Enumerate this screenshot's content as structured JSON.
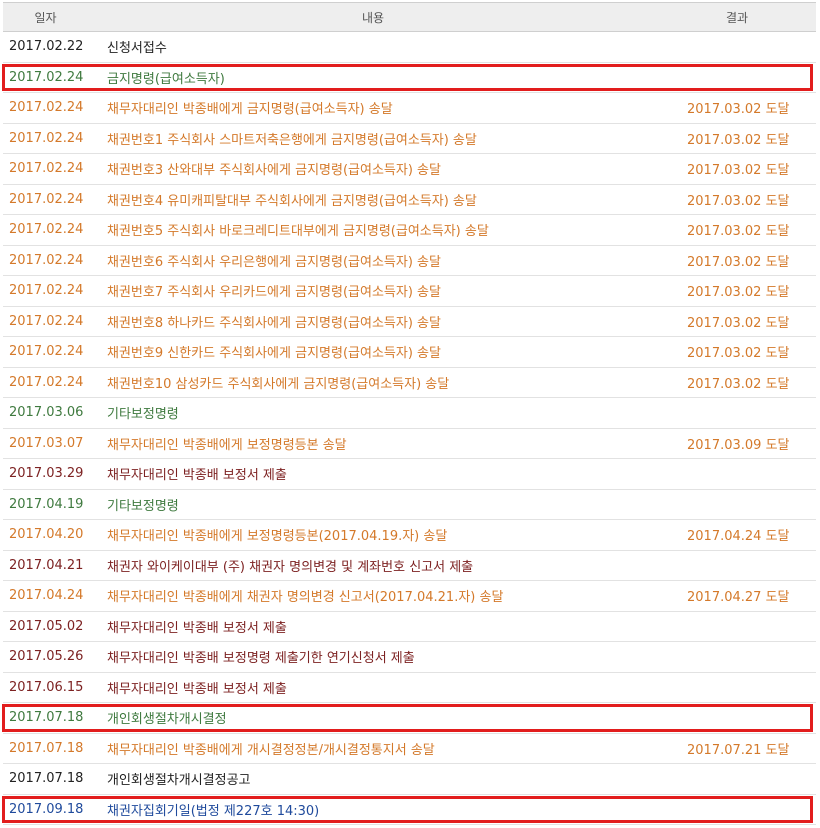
{
  "header": {
    "date": "일자",
    "content": "내용",
    "result": "결과"
  },
  "colors": {
    "black": "#222222",
    "green": "#3f7a3f",
    "orange": "#d4792a",
    "maroon": "#7d2222",
    "blue": "#1f4a9c",
    "highlight_border": "#e21d1d"
  },
  "rows": [
    {
      "date": "2017.02.22",
      "content": "신청서접수",
      "result": "",
      "color": "black",
      "highlight": false
    },
    {
      "date": "2017.02.24",
      "content": "금지명령(급여소득자)",
      "result": "",
      "color": "green",
      "highlight": true
    },
    {
      "date": "2017.02.24",
      "content": "채무자대리인 박종배에게 금지명령(급여소득자) 송달",
      "result": "2017.03.02 도달",
      "color": "orange",
      "highlight": false
    },
    {
      "date": "2017.02.24",
      "content": "채권번호1 주식회사 스마트저축은행에게 금지명령(급여소득자) 송달",
      "result": "2017.03.02 도달",
      "color": "orange",
      "highlight": false
    },
    {
      "date": "2017.02.24",
      "content": "채권번호3 산와대부 주식회사에게 금지명령(급여소득자) 송달",
      "result": "2017.03.02 도달",
      "color": "orange",
      "highlight": false
    },
    {
      "date": "2017.02.24",
      "content": "채권번호4 유미캐피탈대부 주식회사에게 금지명령(급여소득자) 송달",
      "result": "2017.03.02 도달",
      "color": "orange",
      "highlight": false
    },
    {
      "date": "2017.02.24",
      "content": "채권번호5 주식회사 바로크레디트대부에게 금지명령(급여소득자) 송달",
      "result": "2017.03.02 도달",
      "color": "orange",
      "highlight": false
    },
    {
      "date": "2017.02.24",
      "content": "채권번호6 주식회사 우리은행에게 금지명령(급여소득자) 송달",
      "result": "2017.03.02 도달",
      "color": "orange",
      "highlight": false
    },
    {
      "date": "2017.02.24",
      "content": "채권번호7 주식회사 우리카드에게 금지명령(급여소득자) 송달",
      "result": "2017.03.02 도달",
      "color": "orange",
      "highlight": false
    },
    {
      "date": "2017.02.24",
      "content": "채권번호8 하나카드 주식회사에게 금지명령(급여소득자) 송달",
      "result": "2017.03.02 도달",
      "color": "orange",
      "highlight": false
    },
    {
      "date": "2017.02.24",
      "content": "채권번호9 신한카드 주식회사에게 금지명령(급여소득자) 송달",
      "result": "2017.03.02 도달",
      "color": "orange",
      "highlight": false
    },
    {
      "date": "2017.02.24",
      "content": "채권번호10 삼성카드 주식회사에게 금지명령(급여소득자) 송달",
      "result": "2017.03.02 도달",
      "color": "orange",
      "highlight": false
    },
    {
      "date": "2017.03.06",
      "content": "기타보정명령",
      "result": "",
      "color": "green",
      "highlight": false
    },
    {
      "date": "2017.03.07",
      "content": "채무자대리인 박종배에게 보정명령등본 송달",
      "result": "2017.03.09 도달",
      "color": "orange",
      "highlight": false
    },
    {
      "date": "2017.03.29",
      "content": "채무자대리인 박종배 보정서 제출",
      "result": "",
      "color": "maroon",
      "highlight": false
    },
    {
      "date": "2017.04.19",
      "content": "기타보정명령",
      "result": "",
      "color": "green",
      "highlight": false
    },
    {
      "date": "2017.04.20",
      "content": "채무자대리인 박종배에게 보정명령등본(2017.04.19.자) 송달",
      "result": "2017.04.24 도달",
      "color": "orange",
      "highlight": false
    },
    {
      "date": "2017.04.21",
      "content": "채권자 와이케이대부 (주) 채권자 명의변경 및 계좌번호 신고서 제출",
      "result": "",
      "color": "maroon",
      "highlight": false
    },
    {
      "date": "2017.04.24",
      "content": "채무자대리인 박종배에게 채권자 명의변경 신고서(2017.04.21.자) 송달",
      "result": "2017.04.27 도달",
      "color": "orange",
      "highlight": false
    },
    {
      "date": "2017.05.02",
      "content": "채무자대리인 박종배 보정서 제출",
      "result": "",
      "color": "maroon",
      "highlight": false
    },
    {
      "date": "2017.05.26",
      "content": "채무자대리인 박종배 보정명령 제출기한 연기신청서 제출",
      "result": "",
      "color": "maroon",
      "highlight": false
    },
    {
      "date": "2017.06.15",
      "content": "채무자대리인 박종배 보정서 제출",
      "result": "",
      "color": "maroon",
      "highlight": false
    },
    {
      "date": "2017.07.18",
      "content": "개인회생절차개시결정",
      "result": "",
      "color": "green",
      "highlight": true
    },
    {
      "date": "2017.07.18",
      "content": "채무자대리인 박종배에게 개시결정정본/개시결정통지서 송달",
      "result": "2017.07.21 도달",
      "color": "orange",
      "highlight": false
    },
    {
      "date": "2017.07.18",
      "content": "개인회생절차개시결정공고",
      "result": "",
      "color": "black",
      "highlight": false
    },
    {
      "date": "2017.09.18",
      "content": "채권자집회기일(법정 제227호 14:30)",
      "result": "",
      "color": "blue",
      "highlight": true
    }
  ]
}
